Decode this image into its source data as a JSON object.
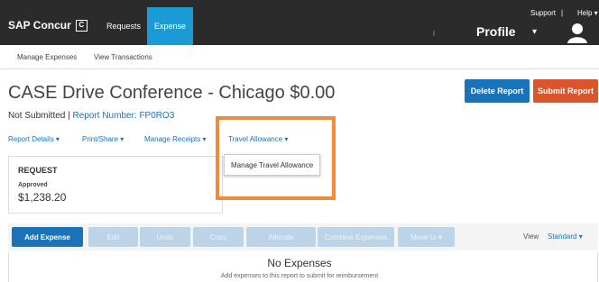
{
  "brand": {
    "name": "SAP Concur",
    "logo_glyph": "C"
  },
  "top_nav": {
    "requests": "Requests",
    "expense": "Expense"
  },
  "header_links": {
    "support": "Support",
    "separator": "|",
    "help": "Help ▾"
  },
  "profile": {
    "label": "Profile",
    "caret": "▾"
  },
  "sub_nav": {
    "manage_expenses": "Manage Expenses",
    "view_transactions": "View Transactions"
  },
  "report": {
    "title": "CASE Drive Conference - Chicago $0.00",
    "status": "Not Submitted |",
    "report_number": "Report Number: FP0RO3"
  },
  "actions": {
    "delete": "Delete Report",
    "submit": "Submit Report"
  },
  "report_menus": {
    "details": "Report Details ▾",
    "print_share": "Print/Share ▾",
    "manage_receipts": "Manage Receipts ▾",
    "travel_allowance": "Travel Allowance ▾"
  },
  "travel_allowance_dropdown": {
    "item": "Manage Travel Allowance"
  },
  "request_card": {
    "label": "REQUEST",
    "status": "Approved",
    "amount": "$1,238.20"
  },
  "toolbar": {
    "add_expense": "Add Expense",
    "edit": "Edit",
    "undo": "Undo",
    "copy": "Copy",
    "allocate": "Allocate",
    "combine": "Combine Expenses",
    "move_to": "Move to ▾",
    "view_label": "View",
    "view_value": "Standard ▾"
  },
  "empty_state": {
    "title": "No Expenses",
    "subtitle": "Add expenses to this report to submit for reimbursement"
  },
  "colors": {
    "accent": "#1a73b8",
    "nav_active": "#1a9bd7",
    "submit": "#d9552b",
    "highlight": "#f08a3c"
  }
}
